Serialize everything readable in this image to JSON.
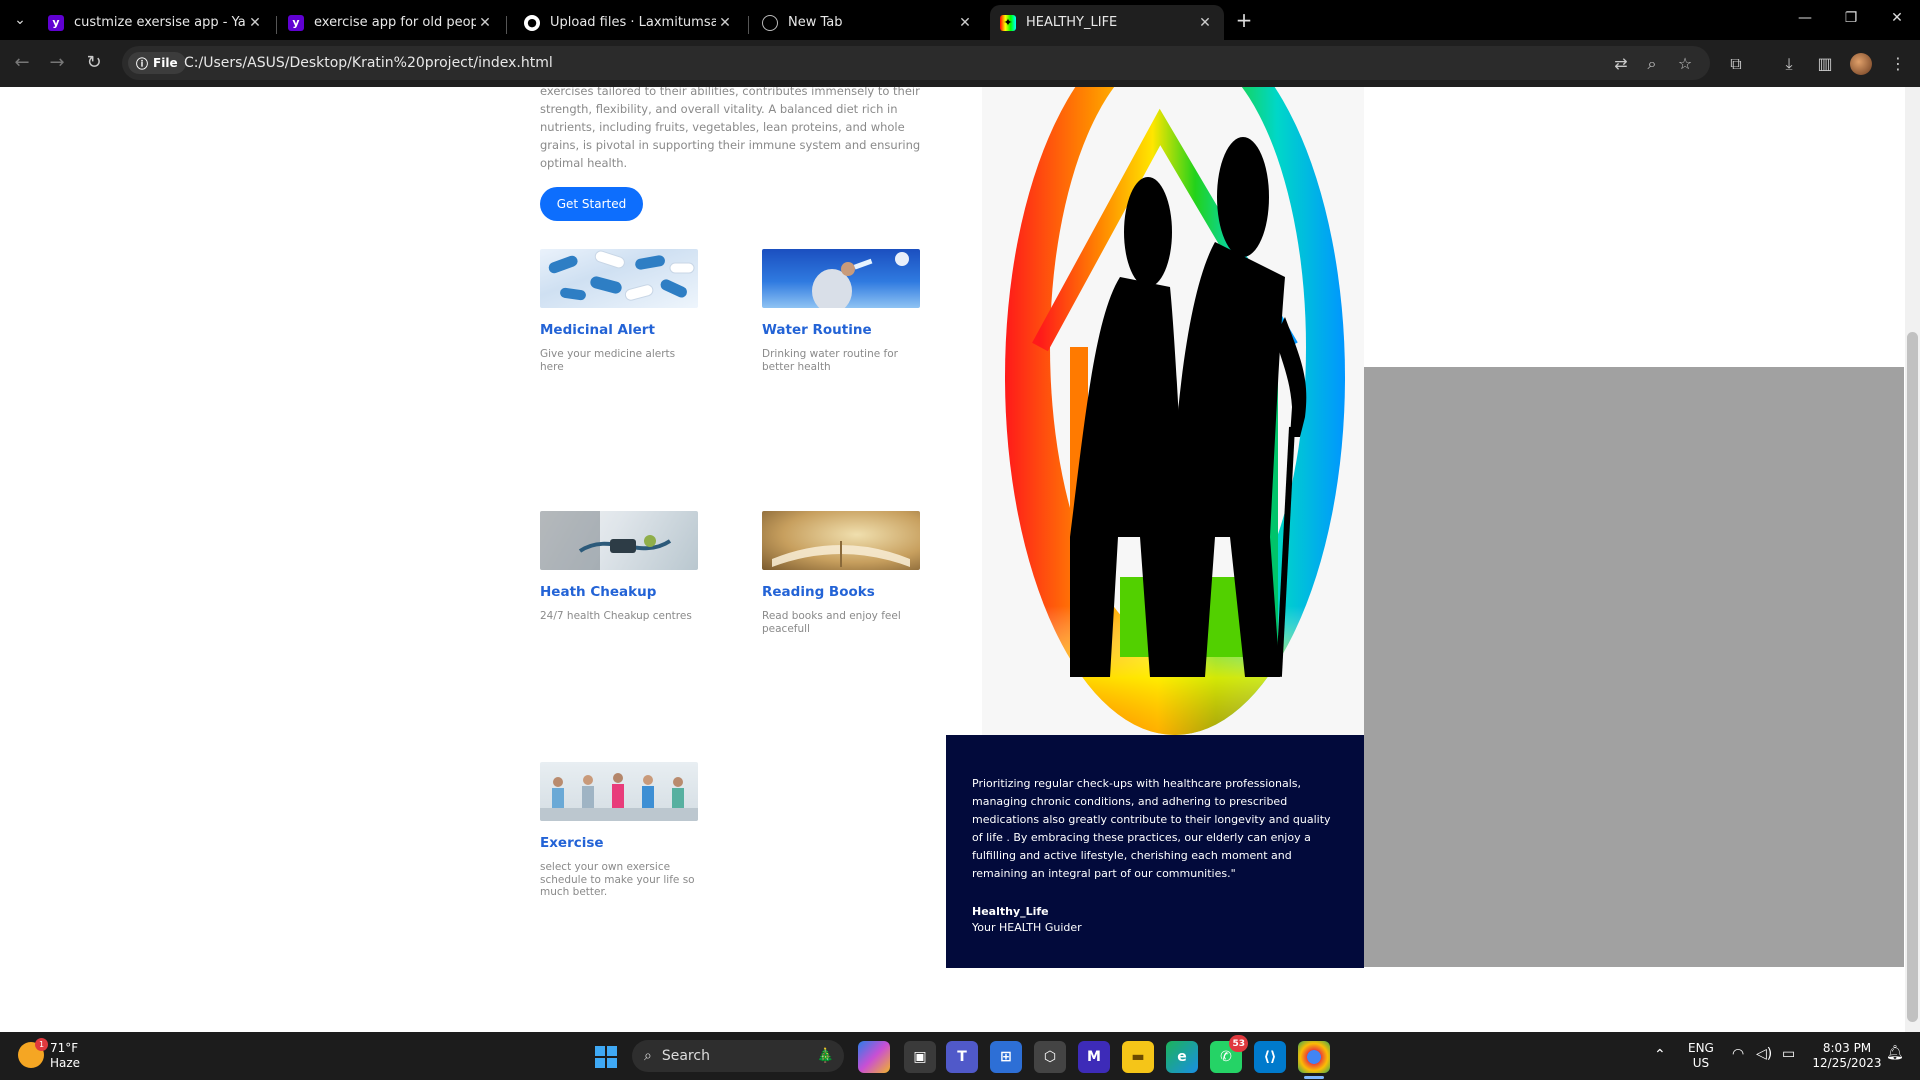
{
  "browser": {
    "tabs": [
      {
        "title": "custmize exersise app - Yahoo S",
        "favicon": "yahoo-icon",
        "active": false
      },
      {
        "title": "exercise app for old people - Ya",
        "favicon": "yahoo-icon",
        "active": false
      },
      {
        "title": "Upload files · Laxmitumsare/He",
        "favicon": "github-icon",
        "active": false
      },
      {
        "title": "New Tab",
        "favicon": "globe-icon",
        "active": false
      },
      {
        "title": "HEALTHY_LIFE",
        "favicon": "healthy-life-logo-icon",
        "active": true
      }
    ],
    "new_tab": "+",
    "window_controls": {
      "minimize": "—",
      "restore": "❐",
      "close": "✕"
    },
    "address": {
      "chip": "File",
      "url": "C:/Users/ASUS/Desktop/Kratin%20project/index.html"
    }
  },
  "page": {
    "intro_text": "exercises tailored to their abilities, contributes immensely to their strength, flexibility, and overall vitality. A balanced diet rich in nutrients, including fruits, vegetables, lean proteins, and whole grains, is pivotal in supporting their immune system and ensuring optimal health.",
    "cta_label": "Get Started",
    "features": [
      {
        "title": "Medicinal Alert",
        "desc": "Give your medicine alerts here",
        "image": "pills-image"
      },
      {
        "title": "Water Routine",
        "desc": "Drinking water routine for better health",
        "image": "drinking-water-image"
      },
      {
        "title": "Heath Cheakup",
        "desc": "24/7 health Cheakup centres",
        "image": "doctor-checkup-image"
      },
      {
        "title": "Reading Books",
        "desc": "Read books and enjoy feel peacefull",
        "image": "open-book-image"
      },
      {
        "title": "Exercise",
        "desc": "select your own exersice schedule to make your life so much better.",
        "image": "group-exercise-image"
      }
    ],
    "quote_text": "Prioritizing regular check-ups with healthcare professionals, managing chronic conditions, and adhering to prescribed medications also greatly contribute to their longevity and quality of life . By embracing these practices, our elderly can enjoy a fulfilling and active lifestyle, cherishing each moment and remaining an integral part of our communities.\"",
    "quote_brand": "Healthy_Life",
    "quote_sub": "Your HEALTH Guider"
  },
  "taskbar": {
    "weather": {
      "temp": "71°F",
      "condition": "Haze",
      "badge": "1"
    },
    "search_label": "Search",
    "whatsapp_badge": "53",
    "lang": {
      "line1": "ENG",
      "line2": "US"
    },
    "clock": {
      "time": "8:03 PM",
      "date": "12/25/2023"
    }
  },
  "colors": {
    "accent": "#0d6efd",
    "title_blue": "#2363d6",
    "quote_bg": "#020a3b",
    "gray_panel": "#a1a1a1"
  }
}
